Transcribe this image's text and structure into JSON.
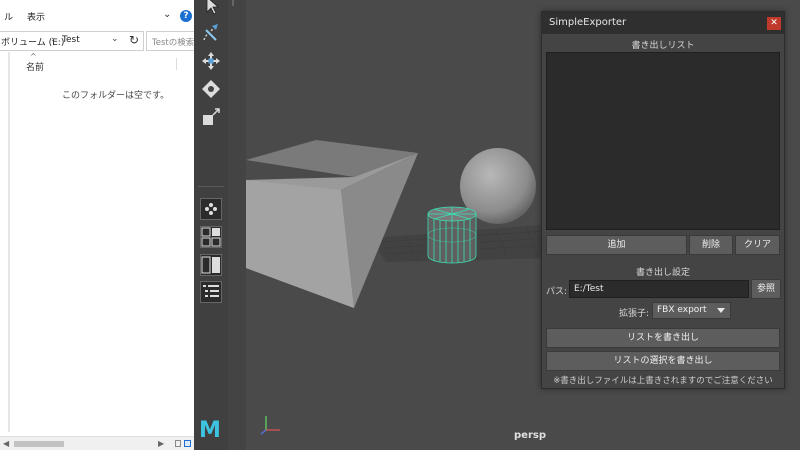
{
  "explorer": {
    "menu": {
      "file": "ル",
      "view": "表示"
    },
    "address": {
      "drive": "ボリューム (E:)",
      "separator": "›",
      "folder": "Test"
    },
    "search_placeholder": "Testの検索",
    "sort_indicator": "^",
    "column_name": "名前",
    "empty_message": "このフォルダーは空です。"
  },
  "toolbox": {
    "tools": [
      "select-tool",
      "paint-select-tool",
      "move-tool",
      "rotate-tool",
      "scale-tool"
    ],
    "layouts": [
      "single-perspective-layout",
      "four-view-layout",
      "two-pane-layout",
      "outliner-layout"
    ],
    "logo": "M"
  },
  "viewport": {
    "camera_label": "persp",
    "axis_labels": {
      "y": "Y",
      "x": "X",
      "z": "Z"
    }
  },
  "exporter": {
    "title": "SimpleExporter",
    "close_glyph": "✕",
    "list_header": "書き出しリスト",
    "buttons": {
      "add": "追加",
      "delete": "削除",
      "clear": "クリア"
    },
    "settings_header": "書き出し設定",
    "path_label": "パス:",
    "path_value": "E:/Test",
    "browse": "参照",
    "extension_label": "拡張子:",
    "extension_value": "FBX export",
    "export_list": "リストを書き出し",
    "export_selected": "リストの選択を書き出し",
    "note": "※書き出しファイルは上書きされますのでご注意ください"
  },
  "colors": {
    "maya_panel": "#444444",
    "list_bg": "#2b2b2b",
    "close_red": "#c03a2b",
    "selection_green": "#37e0b4",
    "maya_logo": "#3cc4e0"
  }
}
